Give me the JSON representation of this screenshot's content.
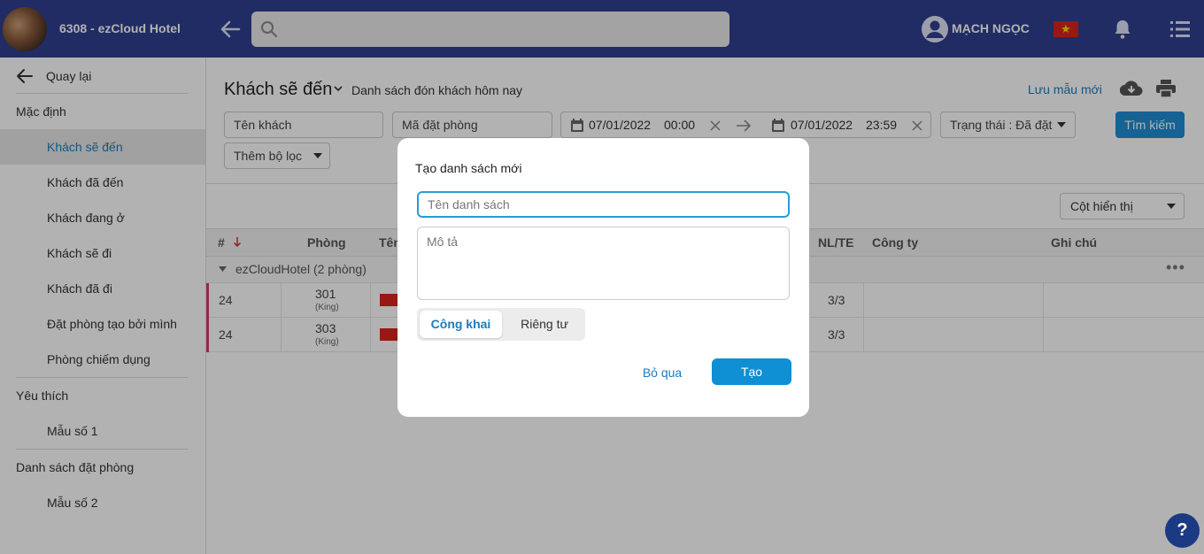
{
  "header": {
    "hotel_name": "6308 - ezCloud Hotel",
    "user_name": "MẠCH NGỌC",
    "search_placeholder": ""
  },
  "sidebar": {
    "back_label": "Quay lại",
    "groups": [
      {
        "label": "Mặc định"
      },
      {
        "label": "Yêu thích"
      },
      {
        "label": "Danh sách đặt phòng"
      }
    ],
    "items": [
      {
        "label": "Khách sẽ đến",
        "active": true
      },
      {
        "label": "Khách đã đến"
      },
      {
        "label": "Khách đang ở"
      },
      {
        "label": "Khách sẽ đi"
      },
      {
        "label": "Khách đã đi"
      },
      {
        "label": "Đặt phòng tạo bởi mình"
      },
      {
        "label": "Phòng chiếm dụng"
      },
      {
        "label": "Mẫu số 1"
      },
      {
        "label": "Mẫu số 2"
      }
    ]
  },
  "main": {
    "title": "Khách sẽ đến",
    "subtitle": "Danh sách đón khách hôm nay",
    "save_template": "Lưu mẫu mới",
    "filters": {
      "guest_name": "Tên khách",
      "booking_code": "Mã đặt phòng",
      "date_from": "07/01/2022",
      "time_from": "00:00",
      "date_to": "07/01/2022",
      "time_to": "23:59",
      "status": "Trạng thái : Đã đặt",
      "search_button": "Tìm kiếm",
      "add_filter": "Thêm bộ lọc"
    },
    "columns_select": "Cột hiển thị",
    "table": {
      "headers": [
        "#",
        "Phòng",
        "Tên",
        "NL/TE",
        "Công ty",
        "Ghi chú"
      ],
      "group_label": "ezCloudHotel (2 phòng)",
      "rows": [
        {
          "num": "24",
          "room": "301",
          "room_type": "(King)",
          "adults_children": "3/3"
        },
        {
          "num": "24",
          "room": "303",
          "room_type": "(King)",
          "adults_children": "3/3"
        }
      ]
    }
  },
  "modal": {
    "title": "Tạo danh sách mới",
    "name_placeholder": "Tên danh sách",
    "desc_placeholder": "Mô tả",
    "public_label": "Công khai",
    "private_label": "Riêng tư",
    "cancel_label": "Bỏ qua",
    "create_label": "Tạo"
  },
  "help": {
    "label": "?"
  },
  "colors": {
    "topbar": "#2e3f8f",
    "accent": "#1a7bbf",
    "primary_button": "#0f8fd4",
    "row_marker": "#d63a6a"
  }
}
